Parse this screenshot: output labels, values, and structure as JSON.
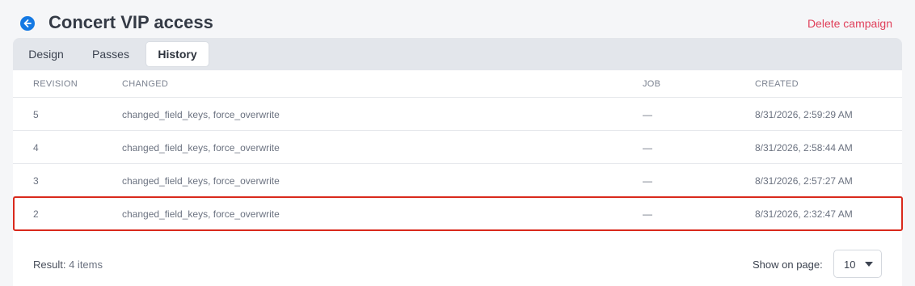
{
  "header": {
    "title": "Concert VIP access",
    "delete_label": "Delete campaign",
    "back_icon": "arrow-left-circle-icon",
    "accent": "#1479e3",
    "danger": "#e0405a"
  },
  "tabs": [
    {
      "label": "Design",
      "active": false
    },
    {
      "label": "Passes",
      "active": false
    },
    {
      "label": "History",
      "active": true
    }
  ],
  "table": {
    "columns": [
      "REVISION",
      "CHANGED",
      "JOB",
      "CREATED"
    ],
    "rows": [
      {
        "revision": "5",
        "changed": "changed_field_keys, force_overwrite",
        "job": "—",
        "created": "8/31/2026, 2:59:29 AM"
      },
      {
        "revision": "4",
        "changed": "changed_field_keys, force_overwrite",
        "job": "—",
        "created": "8/31/2026, 2:58:44 AM"
      },
      {
        "revision": "3",
        "changed": "changed_field_keys, force_overwrite",
        "job": "—",
        "created": "8/31/2026, 2:57:27 AM"
      },
      {
        "revision": "2",
        "changed": "changed_field_keys, force_overwrite",
        "job": "—",
        "created": "8/31/2026, 2:32:47 AM"
      }
    ],
    "highlighted_row": "2"
  },
  "footer": {
    "result_label": "Result:",
    "result_count": "4 items",
    "show_label": "Show on page:",
    "page_size": "10"
  }
}
